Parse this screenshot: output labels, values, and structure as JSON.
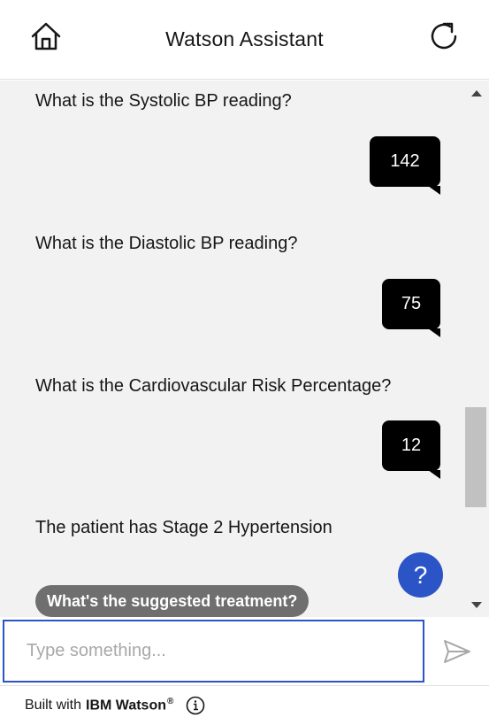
{
  "header": {
    "title": "Watson Assistant",
    "home_icon": "home-icon",
    "restart_icon": "restart-icon"
  },
  "messages": [
    {
      "role": "bot",
      "text": "What is the Systolic BP reading?"
    },
    {
      "role": "user",
      "text": "142"
    },
    {
      "role": "bot",
      "text": "What is the Diastolic BP reading?"
    },
    {
      "role": "user",
      "text": "75"
    },
    {
      "role": "bot",
      "text": "What is the Cardiovascular Risk Percentage?"
    },
    {
      "role": "user",
      "text": "12"
    },
    {
      "role": "bot",
      "text": "The patient has Stage 2 Hypertension"
    }
  ],
  "suggestion": {
    "label": "What's the suggested treatment?"
  },
  "help_button": {
    "label": "?"
  },
  "input": {
    "placeholder": "Type something...",
    "value": ""
  },
  "footer": {
    "prefix": "Built with",
    "brand": "IBM Watson",
    "registered": "®"
  },
  "colors": {
    "accent": "#2b55c7",
    "user_bubble": "#000000",
    "chat_background": "#f2f2f2",
    "chip": "#6f6f6f"
  }
}
